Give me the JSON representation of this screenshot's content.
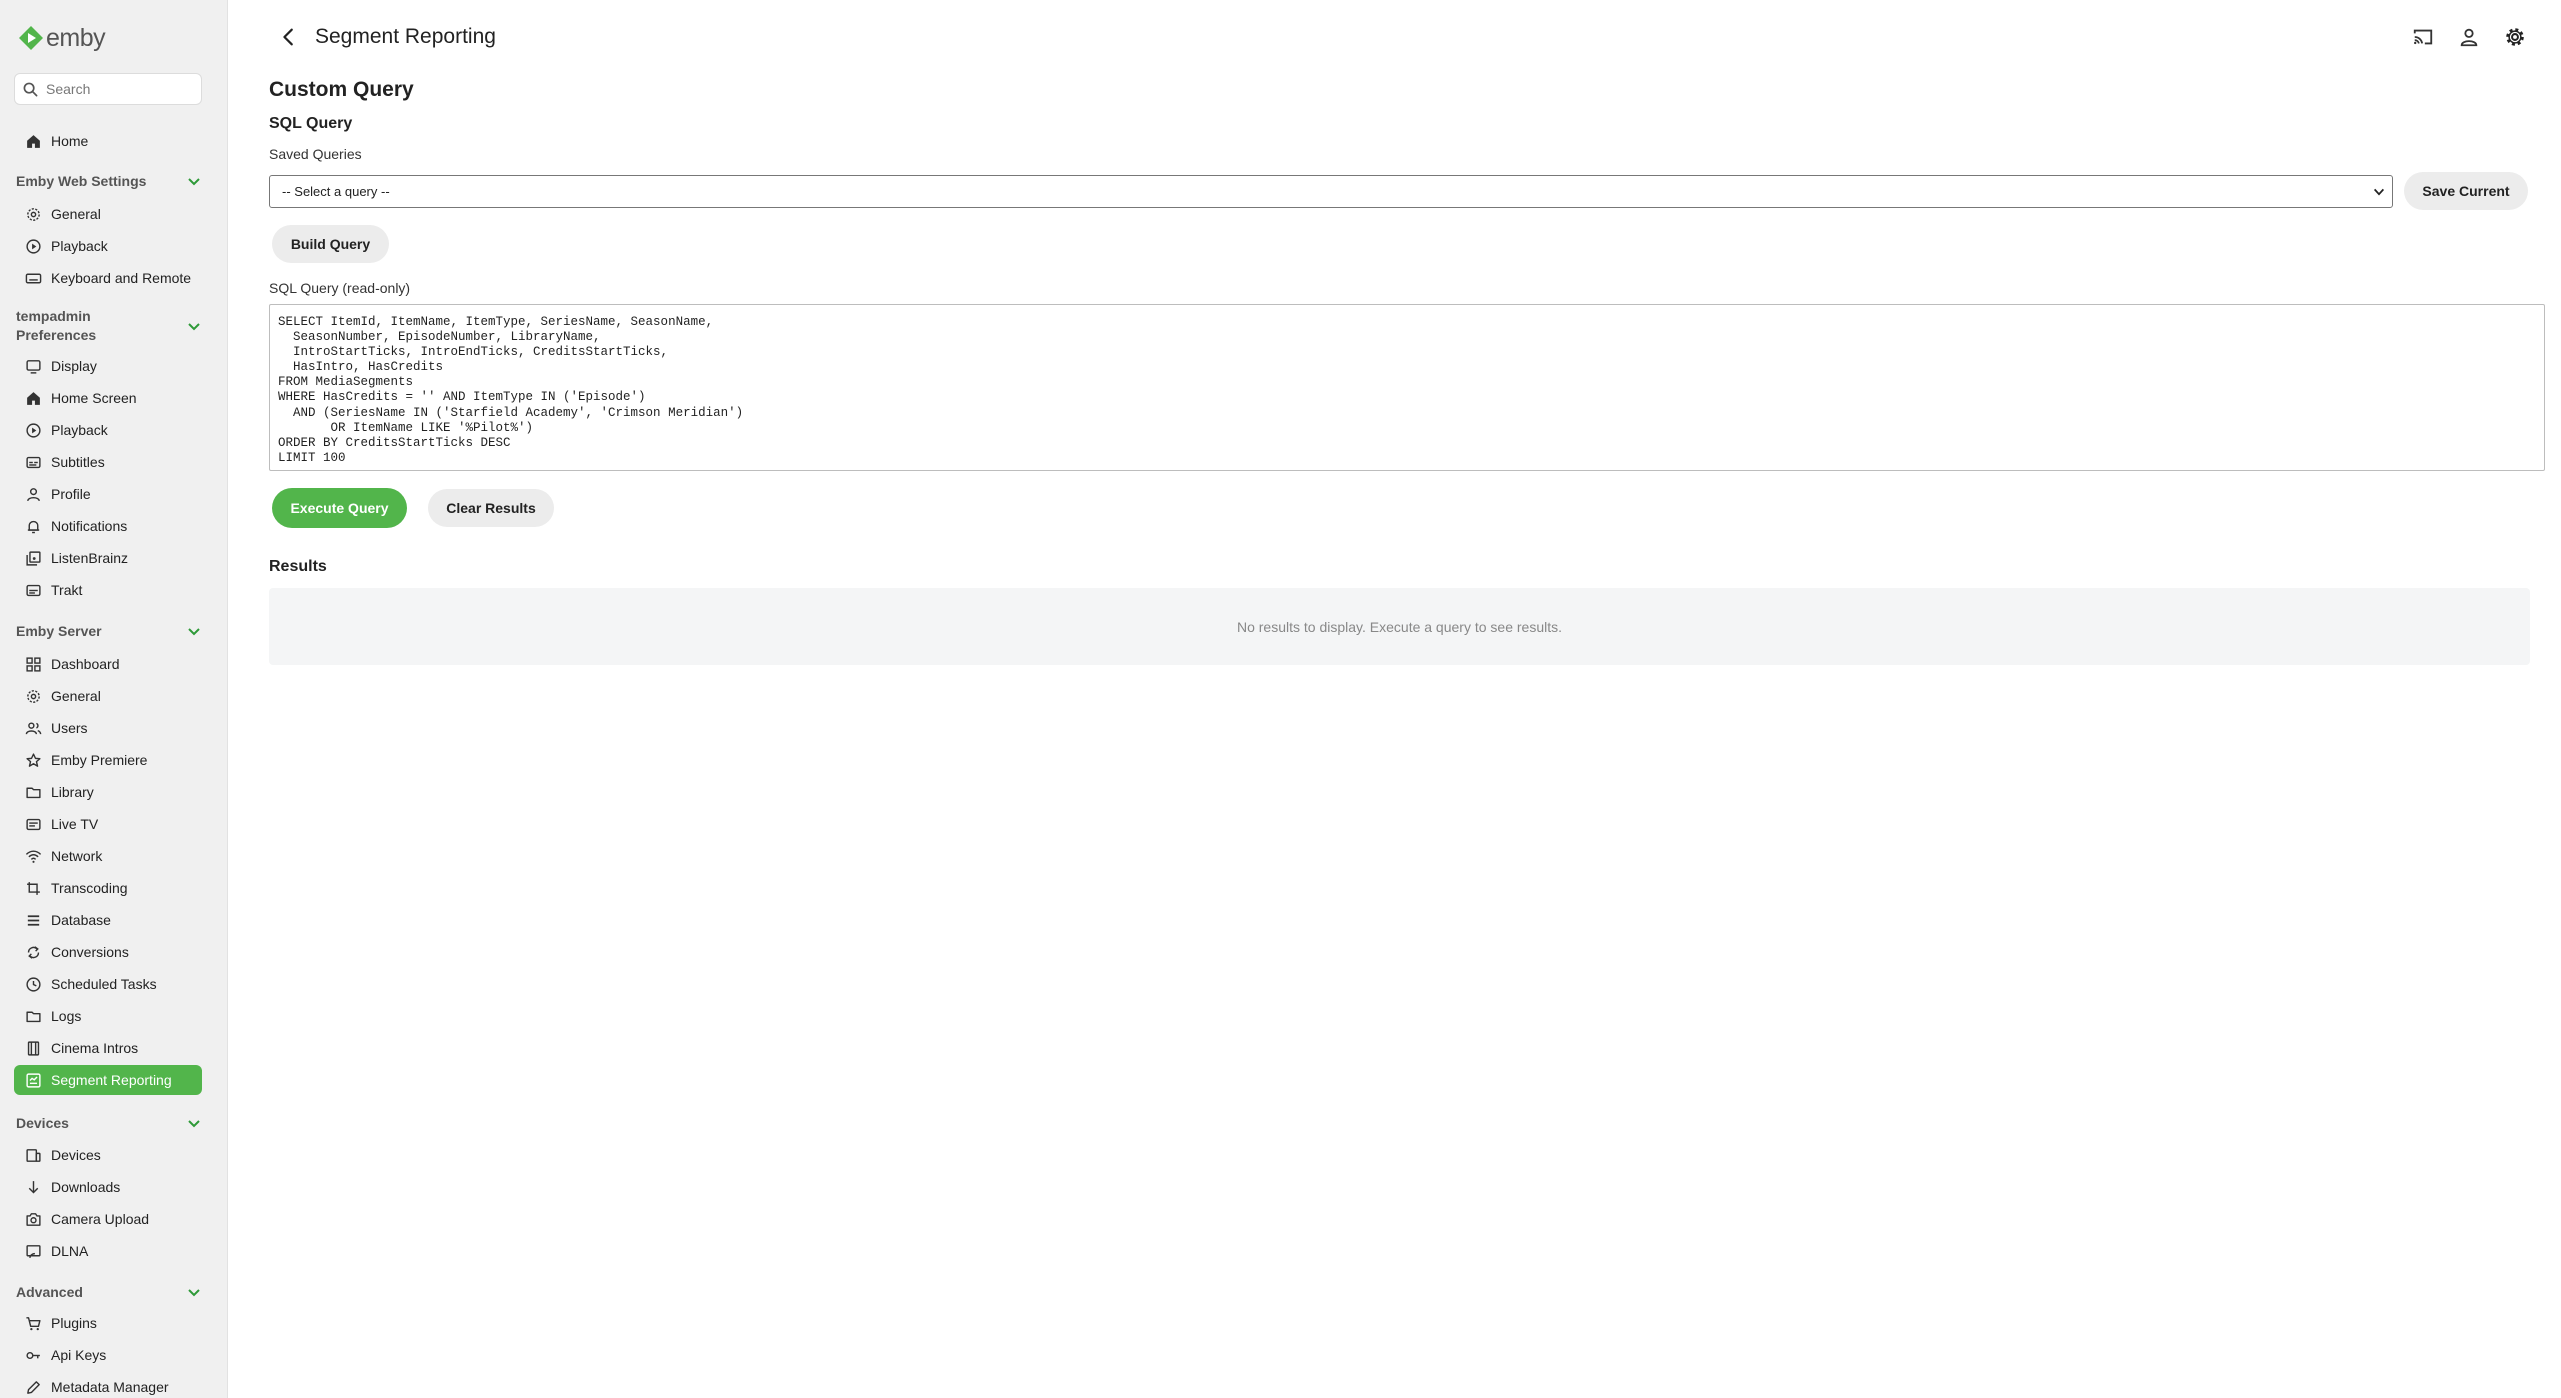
{
  "app": {
    "logo_text": "emby",
    "brand_color": "#52b54b"
  },
  "search": {
    "placeholder": "Search"
  },
  "sidebar": {
    "home": "Home",
    "web_settings": {
      "header": "Emby Web Settings",
      "items": [
        "General",
        "Playback",
        "Keyboard and Remote"
      ]
    },
    "user_prefs": {
      "header_line1": "tempadmin",
      "header_line2": "Preferences",
      "items": [
        "Display",
        "Home Screen",
        "Playback",
        "Subtitles",
        "Profile",
        "Notifications",
        "ListenBrainz",
        "Trakt"
      ]
    },
    "server": {
      "header": "Emby Server",
      "items": [
        "Dashboard",
        "General",
        "Users",
        "Emby Premiere",
        "Library",
        "Live TV",
        "Network",
        "Transcoding",
        "Database",
        "Conversions",
        "Scheduled Tasks",
        "Logs",
        "Cinema Intros",
        "Segment Reporting"
      ]
    },
    "devices": {
      "header": "Devices",
      "items": [
        "Devices",
        "Downloads",
        "Camera Upload",
        "DLNA"
      ]
    },
    "advanced": {
      "header": "Advanced",
      "items": [
        "Plugins",
        "Api Keys",
        "Metadata Manager"
      ]
    }
  },
  "header": {
    "title": "Segment Reporting",
    "icons": [
      "cast-icon",
      "user-icon",
      "settings-icon"
    ]
  },
  "main": {
    "heading": "Custom Query",
    "sql_heading": "SQL Query",
    "saved_label": "Saved Queries",
    "saved_selected": "-- Select a query --",
    "save_current_label": "Save Current",
    "build_query_label": "Build Query",
    "sql_readonly_label": "SQL Query (read-only)",
    "sql_text": "SELECT ItemId, ItemName, ItemType, SeriesName, SeasonName,\n  SeasonNumber, EpisodeNumber, LibraryName,\n  IntroStartTicks, IntroEndTicks, CreditsStartTicks,\n  HasIntro, HasCredits\nFROM MediaSegments\nWHERE HasCredits = '' AND ItemType IN ('Episode')\n  AND (SeriesName IN ('Starfield Academy', 'Crimson Meridian')\n       OR ItemName LIKE '%Pilot%')\nORDER BY CreditsStartTicks DESC\nLIMIT 100",
    "execute_label": "Execute Query",
    "clear_label": "Clear Results",
    "results_heading": "Results",
    "results_empty": "No results to display. Execute a query to see results."
  }
}
